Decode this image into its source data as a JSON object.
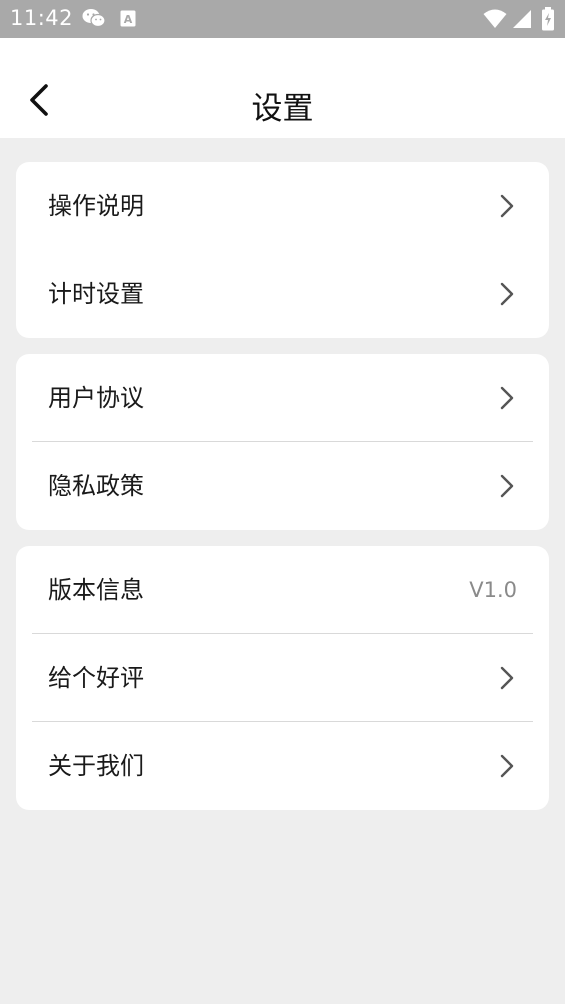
{
  "status_bar": {
    "time": "11:42",
    "icons": [
      "wechat-icon",
      "accessibility-icon",
      "wifi-icon",
      "signal-icon",
      "battery-icon"
    ]
  },
  "header": {
    "title": "设置",
    "back_icon": "chevron-left-icon"
  },
  "groups": [
    {
      "items": [
        {
          "label": "操作说明",
          "icon": "chevron-right-icon"
        },
        {
          "label": "计时设置",
          "icon": "chevron-right-icon"
        }
      ]
    },
    {
      "items": [
        {
          "label": "用户协议",
          "icon": "chevron-right-icon"
        },
        {
          "label": "隐私政策",
          "icon": "chevron-right-icon"
        }
      ]
    },
    {
      "items": [
        {
          "label": "版本信息",
          "value": "V1.0"
        },
        {
          "label": "给个好评",
          "icon": "chevron-right-icon"
        },
        {
          "label": "关于我们",
          "icon": "chevron-right-icon"
        }
      ]
    }
  ],
  "colors": {
    "status_bar_bg": "#a9a9a9",
    "page_bg": "#eeeeee",
    "card_bg": "#ffffff",
    "text": "#1a1a1a",
    "secondary_text": "#8a8a8a",
    "chevron": "#555555",
    "divider": "#d9d9d9"
  }
}
